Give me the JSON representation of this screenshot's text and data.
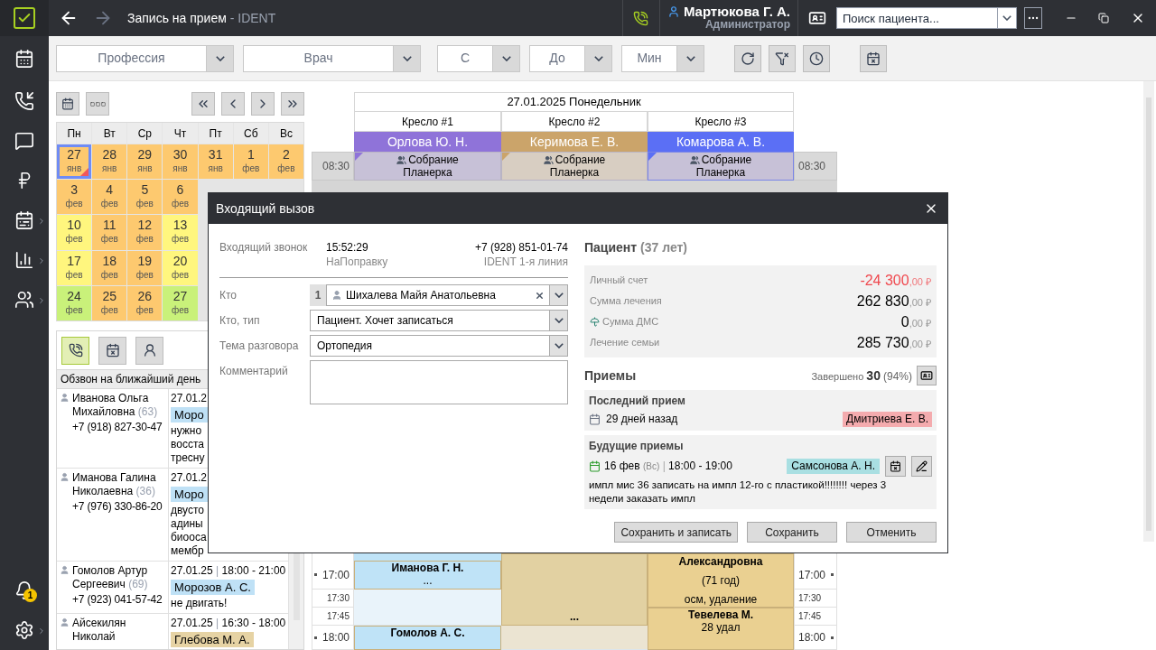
{
  "app": {
    "title": "Запись на прием",
    "title_suffix": " - IDENT",
    "user": {
      "name": "Мартюкова Г. А.",
      "role": "Администратор"
    },
    "search": {
      "placeholder": "Поиск пациента..."
    }
  },
  "sidebar": {
    "items": [
      {
        "kind": "calendar",
        "submenu": false
      },
      {
        "kind": "calls",
        "submenu": false
      },
      {
        "kind": "chat",
        "submenu": false
      },
      {
        "kind": "payments",
        "submenu": false
      },
      {
        "kind": "schedule",
        "submenu": true
      },
      {
        "kind": "reports",
        "submenu": true
      },
      {
        "kind": "patients",
        "submenu": true
      }
    ],
    "bottom_items": [
      {
        "kind": "notifications",
        "submenu": false,
        "badge": "1"
      },
      {
        "kind": "settings",
        "submenu": true
      }
    ]
  },
  "filters": [
    {
      "placeholder": "Профессия",
      "kind": "wide"
    },
    {
      "placeholder": "Врач",
      "kind": "wide"
    },
    {
      "placeholder": "С",
      "kind": "narrow"
    },
    {
      "placeholder": "До",
      "kind": "narrow"
    },
    {
      "placeholder": "Мин",
      "kind": "narrow"
    }
  ],
  "toolbar_buttons": [
    {
      "kind": "refresh"
    },
    {
      "kind": "clear-filter"
    },
    {
      "kind": "clock"
    },
    {
      "kind": "calendar"
    }
  ],
  "calendar": {
    "weekdays": [
      "Пн",
      "Вт",
      "Ср",
      "Чт",
      "Пт",
      "Сб",
      "Вс"
    ],
    "weeks": [
      {
        "days": [
          {
            "day": "27",
            "month": "янв",
            "color": "#fdc96f",
            "selected": true,
            "today": true
          },
          {
            "day": "28",
            "month": "янв",
            "color": "#fdc96f",
            "selected": false,
            "today": false
          },
          {
            "day": "29",
            "month": "янв",
            "color": "#fdc96f",
            "selected": false,
            "today": false
          },
          {
            "day": "30",
            "month": "янв",
            "color": "#fdc96f",
            "selected": false,
            "today": false
          },
          {
            "day": "31",
            "month": "янв",
            "color": "#fdc96f",
            "selected": false,
            "today": false
          },
          {
            "day": "1",
            "month": "фев",
            "color": "#fdc96f",
            "selected": false,
            "today": false
          },
          {
            "day": "2",
            "month": "фев",
            "color": "#fdc96f",
            "selected": false,
            "today": false
          }
        ]
      },
      {
        "days": [
          {
            "day": "3",
            "month": "фев",
            "color": "#fdc96f",
            "selected": false,
            "today": false
          },
          {
            "day": "4",
            "month": "фев",
            "color": "#fdc96f",
            "selected": false,
            "today": false
          },
          {
            "day": "5",
            "month": "фев",
            "color": "#fdc96f",
            "selected": false,
            "today": false
          },
          {
            "day": "6",
            "month": "фев",
            "color": "#fdc96f",
            "selected": false,
            "today": false
          }
        ]
      },
      {
        "days": [
          {
            "day": "10",
            "month": "фев",
            "color": "#fff67e",
            "selected": false,
            "today": false
          },
          {
            "day": "11",
            "month": "фев",
            "color": "#fdc96f",
            "selected": false,
            "today": false
          },
          {
            "day": "12",
            "month": "фев",
            "color": "#fdc96f",
            "selected": false,
            "today": false
          },
          {
            "day": "13",
            "month": "фев",
            "color": "#fff67e",
            "selected": false,
            "today": false
          }
        ]
      },
      {
        "days": [
          {
            "day": "17",
            "month": "фев",
            "color": "#fff67e",
            "selected": false,
            "today": false
          },
          {
            "day": "18",
            "month": "фев",
            "color": "#fdc96f",
            "selected": false,
            "today": false
          },
          {
            "day": "19",
            "month": "фев",
            "color": "#fdc96f",
            "selected": false,
            "today": false
          },
          {
            "day": "20",
            "month": "фев",
            "color": "#fff67e",
            "selected": false,
            "today": false
          }
        ]
      },
      {
        "days": [
          {
            "day": "24",
            "month": "фев",
            "color": "#c9f17a",
            "selected": false,
            "today": false
          },
          {
            "day": "25",
            "month": "фев",
            "color": "#fdc96f",
            "selected": false,
            "today": false
          },
          {
            "day": "26",
            "month": "фев",
            "color": "#fdc96f",
            "selected": false,
            "today": false
          },
          {
            "day": "27",
            "month": "фев",
            "color": "#c9f17a",
            "selected": false,
            "today": false
          }
        ]
      }
    ]
  },
  "calls": {
    "tabs": [
      {
        "kind": "phone",
        "selected": true
      },
      {
        "kind": "calendar-x",
        "selected": false
      },
      {
        "kind": "person-clock",
        "selected": false
      }
    ],
    "title": "Обзвон на ближайший день",
    "rows": [
      {
        "name": "Иванова Ольга Михайловна",
        "age": "(63)",
        "phone": "+7 (918) 827-30-47",
        "date": "27.01.2",
        "doctor": "Моро",
        "color": "#bfe1f6",
        "note": "нужно\nвосста\nтресну"
      },
      {
        "name": "Иманова Галина Николаевна",
        "age": "(36)",
        "phone": "+7 (976) 330-86-20",
        "date": "27.01.2",
        "doctor": "Моро",
        "color": "#bfe1f6",
        "note": "двусто\nадины\nбиооса\nмембр"
      },
      {
        "name": "Гомолов Артур Сергеевич",
        "age": "(69)",
        "phone": "+7 (923) 041-57-42",
        "date": "27.01.25",
        "separator": "|",
        "time": "18:00 - 21:00",
        "doctor": "Морозов А. С.",
        "color": "#bfe1f6",
        "note": "не двигать!"
      },
      {
        "name": "Айсекилян Николай",
        "date": "27.01.25",
        "separator": "|",
        "time": "16:30 - 18:00",
        "doctor": "Глебова М. А.",
        "color": "#e6d3a4"
      }
    ]
  },
  "schedule": {
    "date": "27.01.2025 Понедельник",
    "chairs": [
      {
        "name": "Кресло #1",
        "doctor": "Орлова Ю. Н.",
        "color": "#8f73d9"
      },
      {
        "name": "Кресло #2",
        "doctor": "Керимова Е. В.",
        "color": "#cba46a"
      },
      {
        "name": "Кресло #3",
        "doctor": "Комарова А. В.",
        "color": "#5b6ff5"
      }
    ],
    "first_slot": {
      "time": "08:30",
      "time_right": "08:30",
      "events": [
        {
          "title": "Собрание",
          "subtitle": "Планерка",
          "color": "#c7c1d7",
          "selected": false
        },
        {
          "title": "Собрание",
          "subtitle": "Планерка",
          "color": "#d8cec2",
          "selected": false
        },
        {
          "title": "Собрание",
          "subtitle": "Планерка",
          "color": "#c7c1d7",
          "selected": true
        }
      ]
    },
    "times": [
      {
        "label": "17:00",
        "right_label": "17:00",
        "major": true
      },
      {
        "label": "17:30",
        "right_label": "17:30",
        "major": false
      },
      {
        "label": "17:45",
        "right_label": "17:45",
        "major": false
      },
      {
        "label": "18:00",
        "right_label": "18:00",
        "major": true
      }
    ],
    "blocks": [
      [
        {
          "kind": "booked",
          "color": "#bfe3f7"
        },
        {
          "kind": "booked",
          "lines": [
            "Иманова Г. Н.",
            "..."
          ],
          "color": "#bfe3f7"
        },
        {
          "kind": "free",
          "color": "#e9f3fa"
        },
        {
          "kind": "booked",
          "lines": [
            "Гомолов А. С."
          ],
          "color": "#bfe3f7"
        }
      ],
      [
        {
          "kind": "booked",
          "lines": [
            "..."
          ],
          "color": "#e2d1a2"
        },
        {
          "kind": "free",
          "color": "#ebe4d2"
        }
      ],
      [
        {
          "kind": "booked",
          "lines": [
            "Александровна",
            "(71 год)",
            "осм, удаление"
          ],
          "color": "#ead091"
        },
        {
          "kind": "booked",
          "lines": [
            "Тевелева М.",
            "28 удал"
          ],
          "color": "#ead091"
        }
      ]
    ]
  },
  "dialog": {
    "title": "Входящий вызов",
    "call": {
      "label": "Входящий звонок",
      "time": "15:52:29",
      "source": "НаПоправку",
      "phone": "+7 (928) 851-01-74",
      "line": "IDENT 1-я линия"
    },
    "fields": [
      {
        "kind": "patient",
        "label": "Кто",
        "index": "1",
        "value": "Шихалева Майя Анатольевна"
      },
      {
        "kind": "select",
        "label": "Кто, тип",
        "value": "Пациент. Хочет записаться"
      },
      {
        "kind": "select",
        "label": "Тема разговора",
        "value": "Ортопедия"
      },
      {
        "kind": "textarea",
        "label": "Комментарий"
      }
    ],
    "patient": {
      "title": "Пациент",
      "age": "(37 лет)",
      "balances": [
        {
          "label": "Личный счет",
          "amount": "-24 300",
          "cents": ",00 ₽",
          "negative": true,
          "insured": false
        },
        {
          "label": "Сумма лечения",
          "amount": "262 830",
          "cents": ",00 ₽",
          "negative": false,
          "insured": false
        },
        {
          "label": "Сумма ДМС",
          "amount": "0",
          "cents": ",00 ₽",
          "negative": false,
          "insured": true
        },
        {
          "label": "Лечение семьи",
          "amount": "285 730",
          "cents": ",00 ₽",
          "negative": false,
          "insured": false
        }
      ]
    },
    "visits": {
      "title": "Приемы",
      "done_label": "Завершено",
      "done_count": "30",
      "done_share": "(94%)",
      "last": {
        "title": "Последний прием",
        "when": "29 дней назад",
        "doctor": "Дмитриева Е. В.",
        "color": "#f4abae"
      },
      "future": {
        "title": "Будущие приемы",
        "date": "16 фев",
        "weekday": "(Вс)",
        "separator": "|",
        "time": "18:00 - 19:00",
        "doctor": "Самсонова А. Н.",
        "color": "#a9dfe2",
        "note": "импл мис 36 записать на импл 12-го с пластикой!!!!!!!! через 3 недели заказать импл"
      }
    },
    "buttons": [
      "Сохранить и записать",
      "Сохранить",
      "Отменить"
    ]
  }
}
